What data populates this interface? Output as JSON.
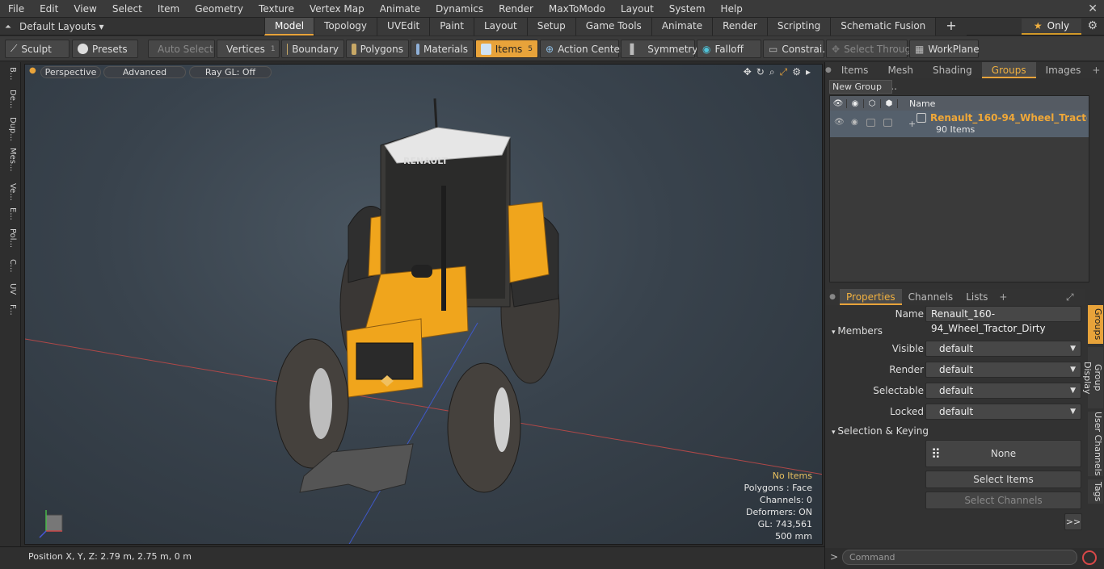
{
  "menu": [
    "File",
    "Edit",
    "View",
    "Select",
    "Item",
    "Geometry",
    "Texture",
    "Vertex Map",
    "Animate",
    "Dynamics",
    "Render",
    "MaxToModo",
    "Layout",
    "System",
    "Help"
  ],
  "layouts_label": "Default Layouts",
  "layout_tabs": [
    "Model",
    "Topology",
    "UVEdit",
    "Paint",
    "Layout",
    "Setup",
    "Game Tools",
    "Animate",
    "Render",
    "Scripting",
    "Schematic Fusion"
  ],
  "active_layout_tab": "Model",
  "only_label": "Only",
  "toolbar": {
    "sculpt": "Sculpt",
    "presets": "Presets",
    "auto_select": "Auto Select",
    "vertices": "Vertices",
    "vertices_count": "1",
    "boundary": "Boundary",
    "polygons": "Polygons",
    "materials": "Materials",
    "items": "Items",
    "items_count": "5",
    "action_center": "Action Center",
    "symmetry": "Symmetry",
    "falloff": "Falloff",
    "constraints": "Constrai...",
    "select_through": "Select Through",
    "workplane": "WorkPlane"
  },
  "left_tabs": [
    "B...",
    "De...",
    "Dup...",
    "Mes...",
    "Ve...",
    "E...",
    "Pol...",
    "C...",
    "UV",
    "F..."
  ],
  "viewport": {
    "perspective": "Perspective",
    "advanced": "Advanced",
    "raygl": "Ray GL: Off",
    "stats": [
      "No Items",
      "Polygons : Face",
      "Channels: 0",
      "Deformers: ON",
      "GL: 743,561",
      "500 mm"
    ]
  },
  "status": "Position X, Y, Z:   2.79 m, 2.75 m, 0 m",
  "right_tabs": [
    "Items",
    "Mesh ...",
    "Shading",
    "Groups",
    "Images"
  ],
  "active_right_tab": "Groups",
  "new_group": "New Group",
  "group_list": {
    "name_header": "Name",
    "group_name": "Renault_160-94_Wheel_Tractor...",
    "group_sub": "90 Items"
  },
  "prop_tabs": [
    "Properties",
    "Channels",
    "Lists"
  ],
  "props": {
    "name_label": "Name",
    "name_value": "Renault_160-94_Wheel_Tractor_Dirty",
    "members": "Members",
    "visible_label": "Visible",
    "render_label": "Render",
    "selectable_label": "Selectable",
    "locked_label": "Locked",
    "default": "default",
    "sel_keying": "Selection & Keying",
    "none": "None",
    "select_items": "Select Items",
    "select_channels": "Select Channels",
    "more": ">>"
  },
  "vert_tabs": [
    "Groups",
    "Group Display",
    "User Channels",
    "Tags"
  ],
  "command_placeholder": "Command",
  "colors": {
    "accent": "#e8a33a",
    "tractor_yellow": "#f0a51c"
  }
}
